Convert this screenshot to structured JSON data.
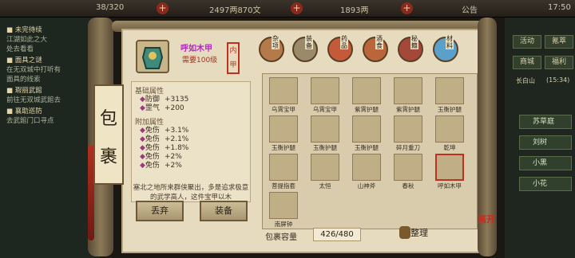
{
  "topbar": {
    "res1": "38/320",
    "res2": "2497两870文",
    "res3": "1893两",
    "notice": "公告",
    "time": "17:50"
  },
  "quests": [
    {
      "title": "■ 未完待续",
      "desc": [
        "江湖如此之大",
        "处去看看"
      ]
    },
    {
      "title": "■ 面具之谜",
      "desc": [
        "在无双城中打听有",
        "面具的线索"
      ]
    },
    {
      "title": "■ 瑕丽武館",
      "desc": [
        "前往无双城武館去"
      ]
    },
    {
      "title": "■ 襄助巡防",
      "desc": [
        "去武館门口寻点"
      ]
    }
  ],
  "right": {
    "btn_activity": "活动",
    "btn_vip": "氪萃",
    "btn_shop": "商城",
    "btn_welfare": "福利",
    "location": "长白山",
    "coords": "(15:34)",
    "party": [
      "苏草庭",
      "刘树",
      "小黑",
      "小花"
    ]
  },
  "window": {
    "title": "包裹",
    "item_name": "呼如木甲",
    "item_req": "需要100级",
    "item_badge": "内甲",
    "base_attr_title": "基础属性",
    "base_attrs": [
      {
        "name": "防御",
        "value": "+3135"
      },
      {
        "name": "罡气",
        "value": "+200"
      }
    ],
    "extra_attr_title": "附加属性",
    "extra_attrs": [
      {
        "name": "免伤",
        "value": "+3.1%"
      },
      {
        "name": "免伤",
        "value": "+2.1%"
      },
      {
        "name": "免伤",
        "value": "+1.8%"
      },
      {
        "name": "免伤",
        "value": "+2%"
      },
      {
        "name": "免伤",
        "value": "+2%"
      }
    ],
    "description": "塞北之地所来群侠聚出，多是追求极意的武学高人，这件宝甲以木",
    "btn_discard": "丢弃",
    "btn_equip": "装备",
    "tabs": [
      "杂项",
      "装备",
      "药品",
      "酒食",
      "秘籍",
      "材料"
    ],
    "items": [
      "乌霄宝甲",
      "乌霄宝甲",
      "紫霄护腿",
      "紫霄护腿",
      "玉衡护腿",
      "玉衡护腿",
      "玉衡护腿",
      "玉衡护腿",
      "碎月重刀",
      "乾坤",
      "菩提指套",
      "太恒",
      "山神斧",
      "春秋",
      "呼如木甲",
      "南屏钟"
    ],
    "capacity_label": "包裹容量",
    "capacity_value": "426/480",
    "sort_label": "整理",
    "stamp": "离开"
  }
}
